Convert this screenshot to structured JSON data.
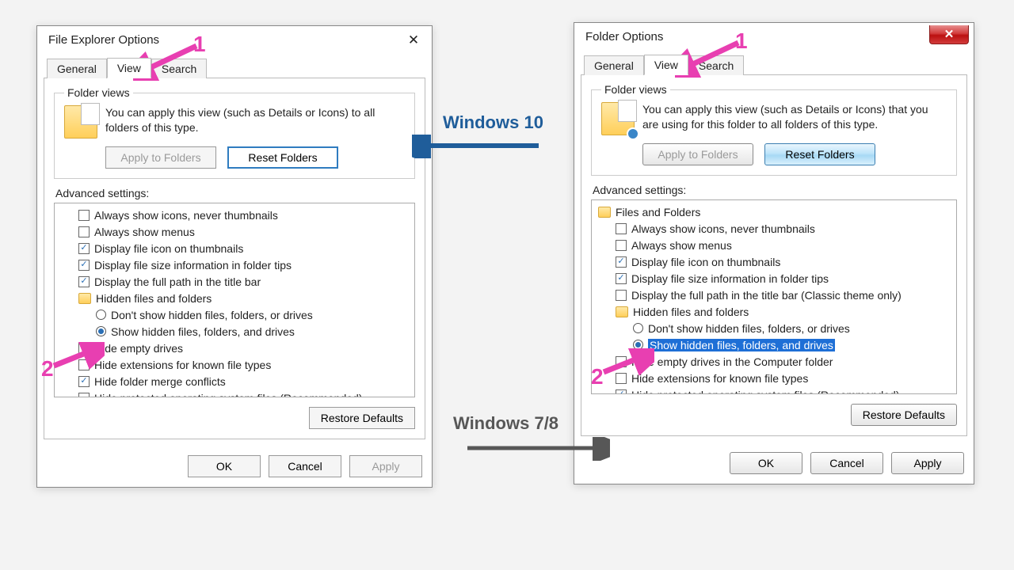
{
  "annotations": {
    "step1": "1",
    "step2": "2",
    "label_w10": "Windows 10",
    "label_w78": "Windows 7/8"
  },
  "w10": {
    "title": "File Explorer Options",
    "tabs": {
      "general": "General",
      "view": "View",
      "search": "Search"
    },
    "folder_views": {
      "legend": "Folder views",
      "text": "You can apply this view (such as Details or Icons) to all folders of this type.",
      "apply": "Apply to Folders",
      "reset": "Reset Folders"
    },
    "advanced_label": "Advanced settings:",
    "rows": [
      {
        "type": "check",
        "checked": false,
        "indent": 1,
        "label": "Always show icons, never thumbnails"
      },
      {
        "type": "check",
        "checked": false,
        "indent": 1,
        "label": "Always show menus"
      },
      {
        "type": "check",
        "checked": true,
        "indent": 1,
        "label": "Display file icon on thumbnails"
      },
      {
        "type": "check",
        "checked": true,
        "indent": 1,
        "label": "Display file size information in folder tips"
      },
      {
        "type": "check",
        "checked": true,
        "indent": 1,
        "label": "Display the full path in the title bar"
      },
      {
        "type": "folder",
        "indent": 1,
        "label": "Hidden files and folders"
      },
      {
        "type": "radio",
        "checked": false,
        "indent": 2,
        "label": "Don't show hidden files, folders, or drives"
      },
      {
        "type": "radio",
        "checked": true,
        "indent": 2,
        "label": "Show hidden files, folders, and drives"
      },
      {
        "type": "check",
        "checked": false,
        "indent": 1,
        "label": "Hide empty drives"
      },
      {
        "type": "check",
        "checked": false,
        "indent": 1,
        "label": "Hide extensions for known file types"
      },
      {
        "type": "check",
        "checked": true,
        "indent": 1,
        "label": "Hide folder merge conflicts"
      },
      {
        "type": "check",
        "checked": false,
        "indent": 1,
        "label": "Hide protected operating system files (Recommended)"
      }
    ],
    "restore": "Restore Defaults",
    "ok": "OK",
    "cancel": "Cancel",
    "apply": "Apply"
  },
  "w7": {
    "title": "Folder Options",
    "tabs": {
      "general": "General",
      "view": "View",
      "search": "Search"
    },
    "folder_views": {
      "legend": "Folder views",
      "text": "You can apply this view (such as Details or Icons) that you are using for this folder to all folders of this type.",
      "apply": "Apply to Folders",
      "reset": "Reset Folders"
    },
    "advanced_label": "Advanced settings:",
    "rows": [
      {
        "type": "folder",
        "indent": 0,
        "label": "Files and Folders"
      },
      {
        "type": "check",
        "checked": false,
        "indent": 1,
        "label": "Always show icons, never thumbnails"
      },
      {
        "type": "check",
        "checked": false,
        "indent": 1,
        "label": "Always show menus"
      },
      {
        "type": "check",
        "checked": true,
        "indent": 1,
        "label": "Display file icon on thumbnails"
      },
      {
        "type": "check",
        "checked": true,
        "indent": 1,
        "label": "Display file size information in folder tips"
      },
      {
        "type": "check",
        "checked": false,
        "indent": 1,
        "label": "Display the full path in the title bar (Classic theme only)"
      },
      {
        "type": "folder",
        "indent": 1,
        "label": "Hidden files and folders"
      },
      {
        "type": "radio",
        "checked": false,
        "indent": 2,
        "label": "Don't show hidden files, folders, or drives"
      },
      {
        "type": "radio",
        "checked": true,
        "indent": 2,
        "label": "Show hidden files, folders, and drives",
        "selected": true
      },
      {
        "type": "check",
        "checked": false,
        "indent": 1,
        "label": "Hide empty drives in the Computer folder"
      },
      {
        "type": "check",
        "checked": false,
        "indent": 1,
        "label": "Hide extensions for known file types"
      },
      {
        "type": "check",
        "checked": true,
        "indent": 1,
        "label": "Hide protected operating system files (Recommended)"
      }
    ],
    "restore": "Restore Defaults",
    "ok": "OK",
    "cancel": "Cancel",
    "apply": "Apply"
  }
}
